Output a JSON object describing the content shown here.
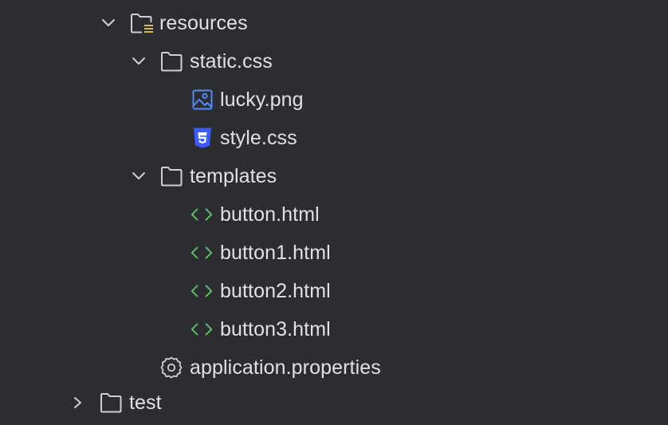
{
  "colors": {
    "background": "#2b2d30",
    "text": "#dfe1e5",
    "icon_stroke": "#ced0d6",
    "html_icon": "#5fb865",
    "css_icon": "#3d5afe",
    "image_icon": "#548af7",
    "resources_badge": "#e0b74a"
  },
  "tree": {
    "resources": {
      "label": "resources",
      "icon": "resources-folder-icon",
      "expanded": true
    },
    "static_css": {
      "label": "static.css",
      "icon": "folder-icon",
      "expanded": true
    },
    "lucky_png": {
      "label": "lucky.png",
      "icon": "image-file-icon"
    },
    "style_css": {
      "label": "style.css",
      "icon": "css-file-icon"
    },
    "templates": {
      "label": "templates",
      "icon": "folder-icon",
      "expanded": true
    },
    "button_html": {
      "label": "button.html",
      "icon": "html-file-icon"
    },
    "button1_html": {
      "label": "button1.html",
      "icon": "html-file-icon"
    },
    "button2_html": {
      "label": "button2.html",
      "icon": "html-file-icon"
    },
    "button3_html": {
      "label": "button3.html",
      "icon": "html-file-icon"
    },
    "application_properties": {
      "label": "application.properties",
      "icon": "settings-file-icon"
    },
    "partial_next": {
      "label": "test",
      "icon": "folder-icon",
      "expanded": false
    }
  }
}
